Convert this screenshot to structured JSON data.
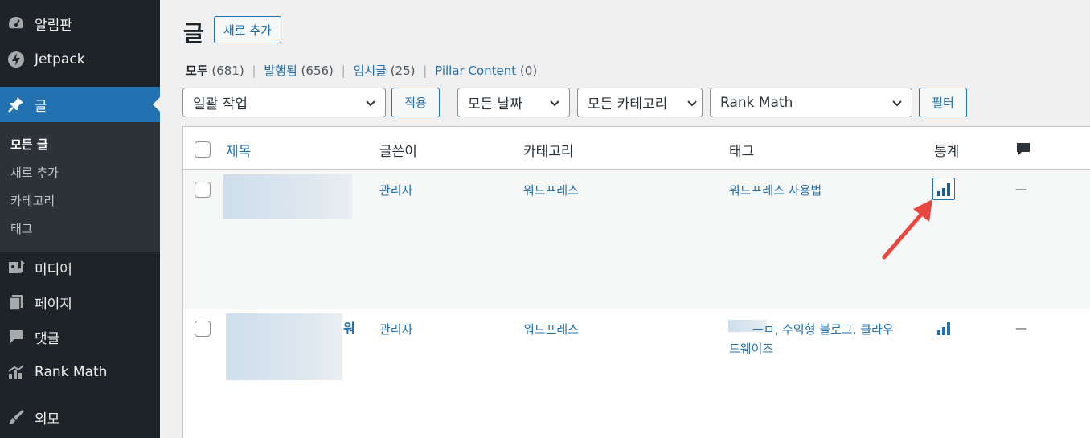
{
  "sidebar": {
    "items": [
      {
        "label": "알림판",
        "icon": "dashboard-icon"
      },
      {
        "label": "Jetpack",
        "icon": "jetpack-icon"
      },
      {
        "label": "글",
        "icon": "pin-icon"
      },
      {
        "label": "미디어",
        "icon": "media-icon"
      },
      {
        "label": "페이지",
        "icon": "page-icon"
      },
      {
        "label": "댓글",
        "icon": "comment-icon"
      },
      {
        "label": "Rank Math",
        "icon": "rank-math-icon"
      },
      {
        "label": "외모",
        "icon": "brush-icon"
      }
    ],
    "submenu": [
      "모든 글",
      "새로 추가",
      "카테고리",
      "태그"
    ]
  },
  "page": {
    "title": "글",
    "add_new": "새로 추가"
  },
  "filters_links": [
    {
      "label": "모두",
      "count": "(681)"
    },
    {
      "label": "발행됨",
      "count": "(656)"
    },
    {
      "label": "임시글",
      "count": "(25)"
    },
    {
      "label": "Pillar Content",
      "count": "(0)"
    }
  ],
  "separator": "|",
  "toolbar": {
    "bulk_action": "일괄 작업",
    "apply": "적용",
    "dates": "모든 날짜",
    "categories": "모든 카테고리",
    "rank_math": "Rank Math",
    "filter": "필터"
  },
  "table": {
    "headers": {
      "title": "제목",
      "author": "글쓴이",
      "categories": "카테고리",
      "tags": "태그",
      "stats": "통계"
    },
    "rows": [
      {
        "author": "관리자",
        "category": "워드프레스",
        "tags": "워드프레스 사용법",
        "comments": "—"
      },
      {
        "title_fragment_1": "워",
        "author": "관리자",
        "category": "워드프레스",
        "tags_line1": "ㅡㅁ, 수익형 블로그, 클라우",
        "tags_line2": "드웨이즈",
        "comments": "—"
      }
    ]
  },
  "colors": {
    "accent": "#2271b1",
    "sidebar": "#1d2327",
    "arrow": "#e8473f"
  }
}
